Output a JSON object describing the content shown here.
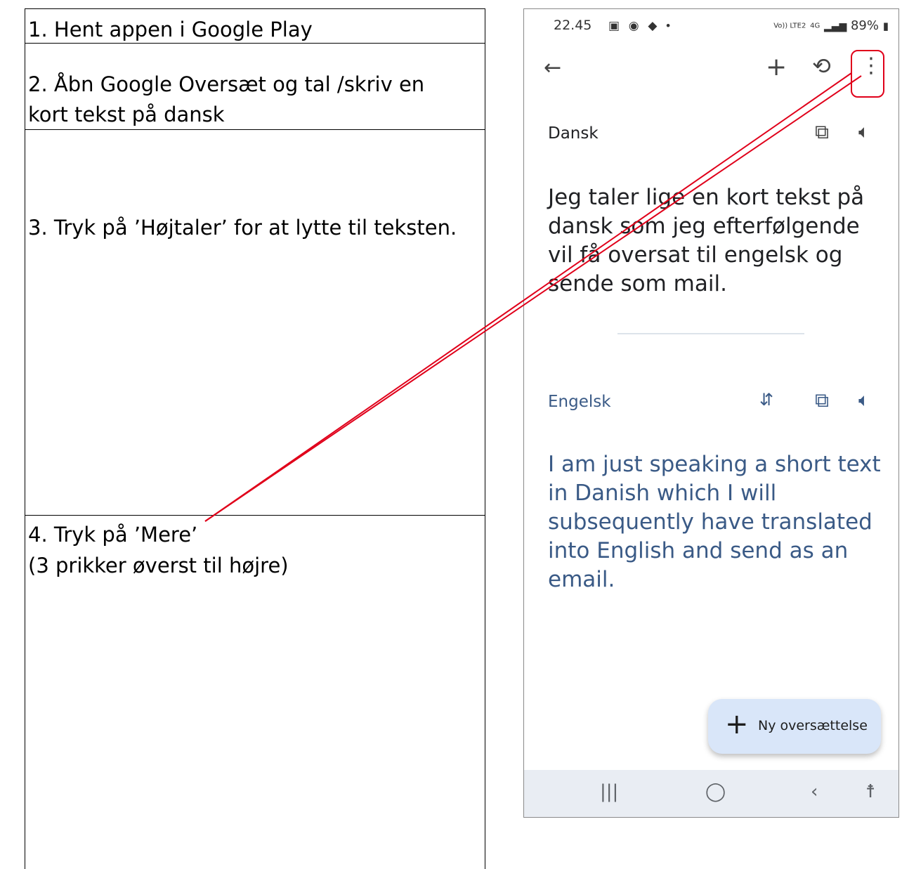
{
  "steps": [
    {
      "text": "1. Hent appen i Google Play"
    },
    {
      "line1": "2. Åbn Google Oversæt og tal /skriv en",
      "line2": "kort tekst på dansk"
    },
    {
      "text": "3. Tryk på ’Højtaler’ for at lytte til teksten."
    },
    {
      "line1": "4. Tryk på ’Mere’",
      "line2": "(3 prikker øverst til højre)"
    }
  ],
  "phone": {
    "status": {
      "time": "22.45",
      "battery": "89%",
      "network": "4G",
      "volte": "Vo)) LTE2"
    },
    "topbar": {
      "back_icon": "arrow-left-icon",
      "add_icon": "plus-icon",
      "history_icon": "history-icon",
      "more_icon": "more-vert-icon"
    },
    "source": {
      "language": "Dansk",
      "text": "Jeg taler lige en kort tekst på dansk som jeg efterfølgende vil få oversat til engelsk og sende som mail."
    },
    "target": {
      "language": "Engelsk",
      "text": "I am just speaking a short text in Danish which I will subsequently have translated into English and send as an email."
    },
    "fab_label": "Ny oversættelse",
    "colors": {
      "source_text": "#202124",
      "target_text": "#3a5a86",
      "fab_bg": "#d9e6f9",
      "highlight": "#e0001a"
    }
  }
}
